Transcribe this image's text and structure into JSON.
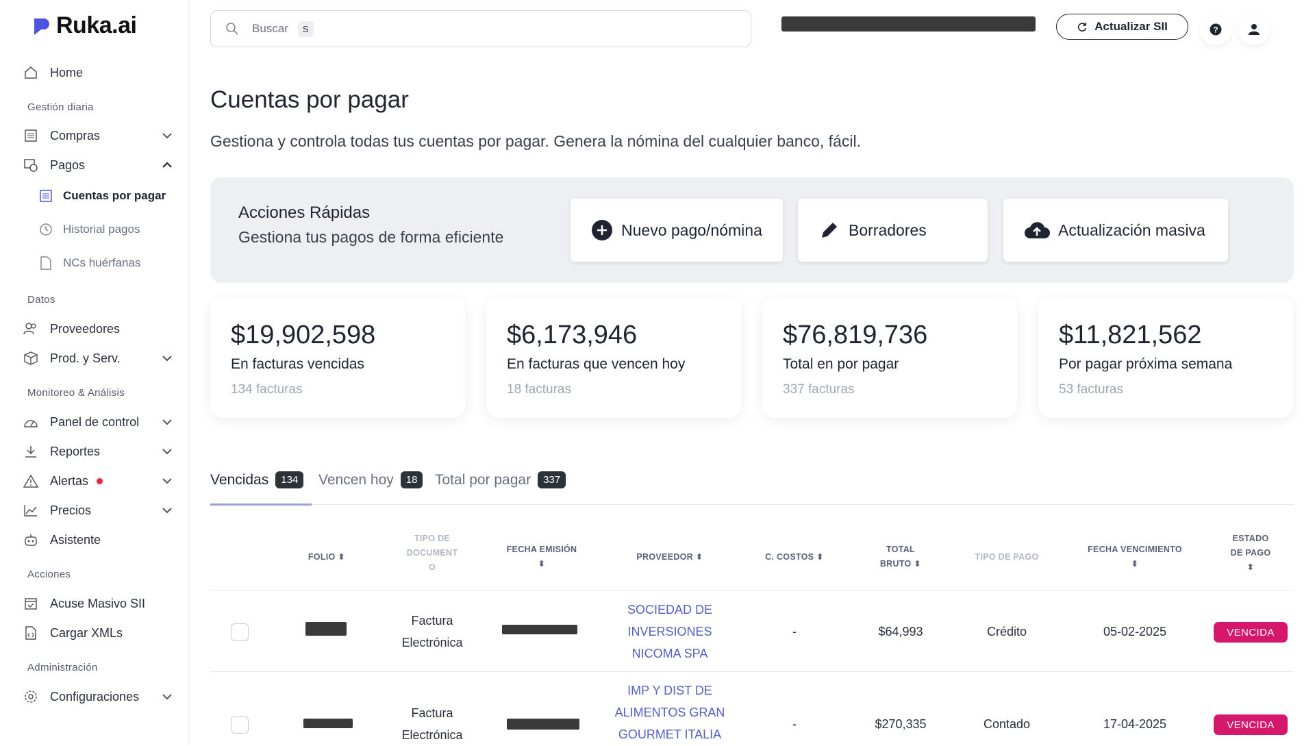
{
  "brand": {
    "name": "Ruka.ai",
    "accent": "#4b55e0"
  },
  "sidebar": {
    "home": "Home",
    "sections": [
      "Gestión diaria",
      "Datos",
      "Monitoreo & Análisis",
      "Acciones",
      "Administración"
    ],
    "compras": "Compras",
    "pagos": "Pagos",
    "pagos_sub": [
      "Cuentas por pagar",
      "Historial pagos",
      "NCs huérfanas"
    ],
    "proveedores": "Proveedores",
    "prod_serv": "Prod. y Serv.",
    "panel": "Panel de control",
    "reportes": "Reportes",
    "alertas": "Alertas",
    "precios": "Precios",
    "asistente": "Asistente",
    "acuse": "Acuse Masivo SII",
    "cargar": "Cargar XMLs",
    "config": "Configuraciones"
  },
  "topbar": {
    "search_placeholder": "Buscar",
    "search_shortcut": "S",
    "sii_button": "Actualizar SII"
  },
  "page": {
    "title": "Cuentas por pagar",
    "subtitle": "Gestiona y controla todas tus cuentas por pagar. Genera la nómina del cualquier banco, fácil."
  },
  "quick": {
    "title": "Acciones Rápidas",
    "subtitle": "Gestiona tus pagos de forma eficiente",
    "buttons": [
      "Nuevo pago/nómina",
      "Borradores",
      "Actualización masiva"
    ]
  },
  "stats": [
    {
      "amount": "$19,902,598",
      "label": "En facturas vencidas",
      "count": "134 facturas"
    },
    {
      "amount": "$6,173,946",
      "label": "En facturas que vencen hoy",
      "count": "18 facturas"
    },
    {
      "amount": "$76,819,736",
      "label": "Total en por pagar",
      "count": "337 facturas"
    },
    {
      "amount": "$11,821,562",
      "label": "Por pagar próxima semana",
      "count": "53 facturas"
    }
  ],
  "tabs": [
    {
      "label": "Vencidas",
      "count": "134"
    },
    {
      "label": "Vencen hoy",
      "count": "18"
    },
    {
      "label": "Total por pagar",
      "count": "337"
    }
  ],
  "table": {
    "headers": {
      "folio": "FOLIO",
      "tipo_doc": [
        "TIPO DE",
        "DOCUMENT",
        "O"
      ],
      "fecha_emision": "FECHA EMISIÓN",
      "proveedor": "PROVEEDOR",
      "c_costos": "C. COSTOS",
      "total_bruto": [
        "TOTAL",
        "BRUTO"
      ],
      "tipo_pago": "TIPO DE PAGO",
      "fecha_venc": "FECHA VENCIMIENTO",
      "estado": [
        "ESTADO",
        "DE PAGO"
      ]
    },
    "rows": [
      {
        "tipo": [
          "Factura",
          "Electrónica"
        ],
        "proveedor": [
          "SOCIEDAD DE",
          "INVERSIONES",
          "NICOMA SPA"
        ],
        "c_costos": "-",
        "total": "$64,993",
        "tipo_pago": "Crédito",
        "fecha_venc": "05-02-2025",
        "estado": "VENCIDA"
      },
      {
        "tipo": [
          "Factura",
          "Electrónica"
        ],
        "proveedor": [
          "IMP Y DIST DE",
          "ALIMENTOS GRAN",
          "GOURMET ITALIA"
        ],
        "c_costos": "-",
        "total": "$270,335",
        "tipo_pago": "Contado",
        "fecha_venc": "17-04-2025",
        "estado": "VENCIDA"
      }
    ]
  }
}
